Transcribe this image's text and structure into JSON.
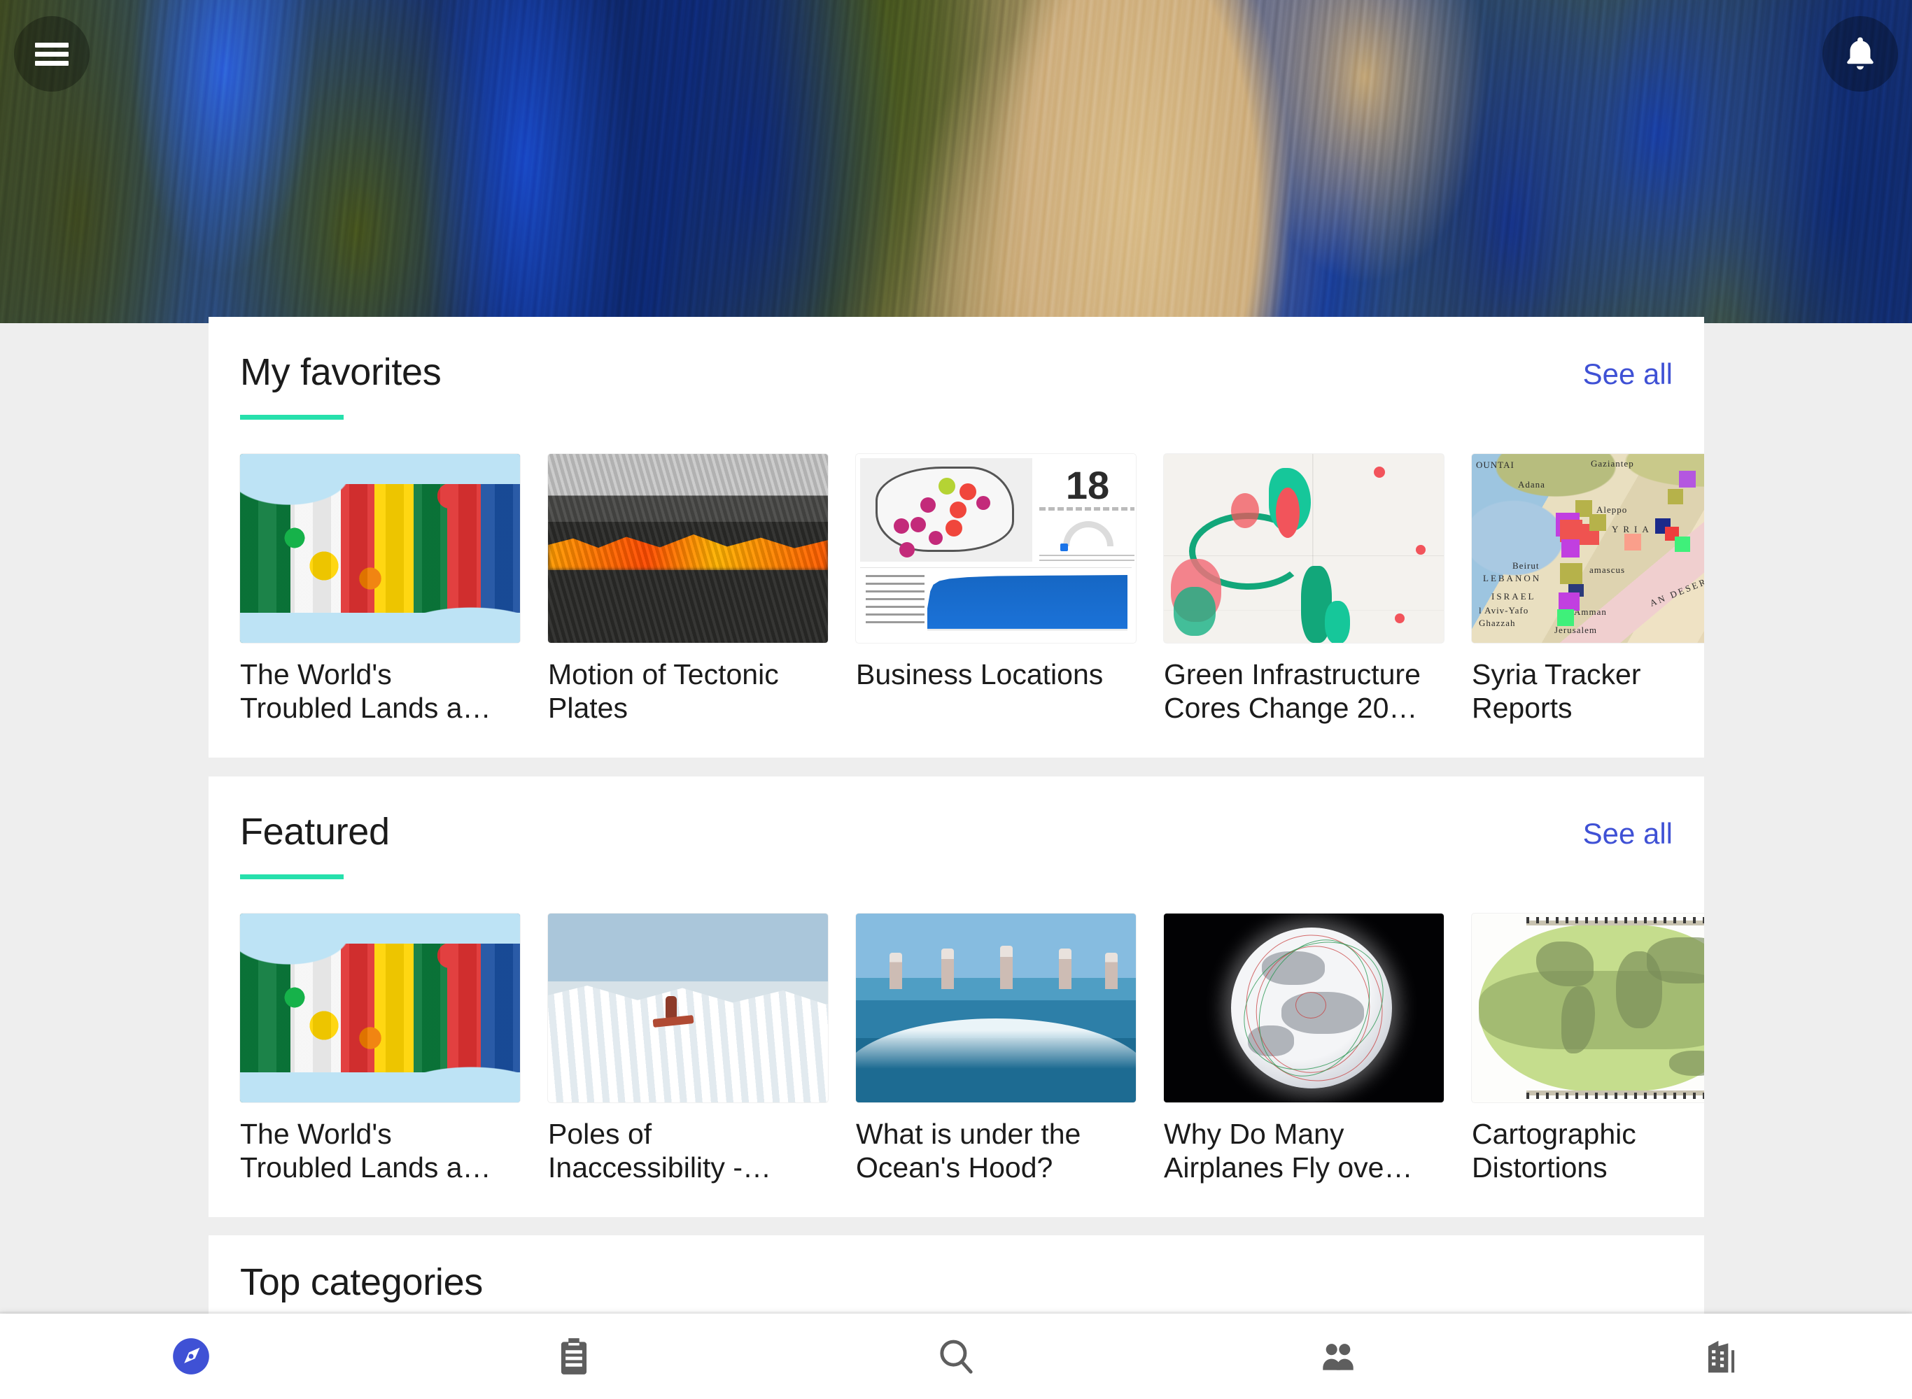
{
  "header": {
    "menu_icon": "hamburger-menu-icon",
    "notification_icon": "bell-icon",
    "hero_alt": "satellite-earth-imagery"
  },
  "sections": [
    {
      "id": "favorites",
      "title": "My favorites",
      "see_all": "See all",
      "cards": [
        {
          "title": "The World's\nTroubled Lands a…",
          "art": "flags"
        },
        {
          "title": "Motion of Tectonic\nPlates",
          "art": "lava"
        },
        {
          "title": "Business Locations",
          "art": "dashboard"
        },
        {
          "title": "Green Infrastructure\nCores Change 20…",
          "art": "gic"
        },
        {
          "title": "Syria Tracker\nReports",
          "art": "syria"
        }
      ]
    },
    {
      "id": "featured",
      "title": "Featured",
      "see_all": "See all",
      "cards": [
        {
          "title": "The World's\nTroubled Lands a…",
          "art": "flags"
        },
        {
          "title": "Poles of\nInaccessibility -…",
          "art": "poles"
        },
        {
          "title": "What is under the\nOcean's Hood?",
          "art": "ocean"
        },
        {
          "title": "Why Do Many\nAirplanes Fly ove…",
          "art": "globe"
        },
        {
          "title": "Cartographic\nDistortions",
          "art": "carto"
        }
      ]
    },
    {
      "id": "topcat",
      "title": "Top categories",
      "see_all": "",
      "cards": []
    }
  ],
  "thumbnail_details": {
    "dashboard": {
      "big_number": "18"
    },
    "syria_labels": [
      "Gaziantep",
      "Adana",
      "Aleppo",
      "SYRIA",
      "Beirut",
      "LEBANON",
      "ISRAEL",
      "Damascus",
      "Amman",
      "Jerusalem",
      "SYRIAN DESERT"
    ]
  },
  "bottom_nav": [
    {
      "icon": "compass-icon",
      "active": true
    },
    {
      "icon": "clipboard-icon",
      "active": false
    },
    {
      "icon": "search-icon",
      "active": false
    },
    {
      "icon": "people-icon",
      "active": false
    },
    {
      "icon": "organization-building-icon",
      "active": false
    }
  ],
  "colors": {
    "accent_rule": "#26e0ac",
    "link": "#3f51d5",
    "nav_active": "#3f51d5",
    "nav_inactive": "#5e5e5e",
    "page_bg": "#eeeeee",
    "card_bg": "#ffffff"
  }
}
